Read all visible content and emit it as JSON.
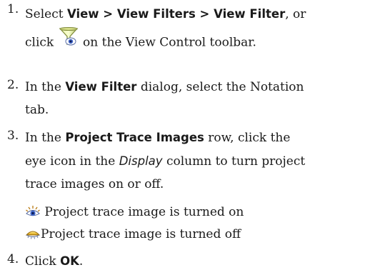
{
  "steps": [
    {
      "number": "1.",
      "text_a": "Select ",
      "menu_path": "View > View Filters > View Filter",
      "text_b": ", or",
      "text_c": "click ",
      "text_d": " on the View Control toolbar.",
      "icon": "view-filter-funnel-icon"
    },
    {
      "number": "2.",
      "text_a": "In the ",
      "dialog_name": "View Filter",
      "text_b": " dialog, select the Notation",
      "text_c": "tab."
    },
    {
      "number": "3.",
      "text_a": "In the ",
      "row_name": "Project Trace Images",
      "text_b": " row, click the",
      "text_c": "eye icon in the ",
      "column_name": "Display",
      "text_d": " column to turn project",
      "text_e": "trace images on or off."
    },
    {
      "number": "4.",
      "text_a": "Click ",
      "button_name": "OK",
      "text_b": "."
    }
  ],
  "legend": {
    "on_label": " Project trace image is turned on",
    "on_icon": "eye-open-icon",
    "off_label": "Project trace image is turned off",
    "off_icon": "eye-closed-icon"
  }
}
